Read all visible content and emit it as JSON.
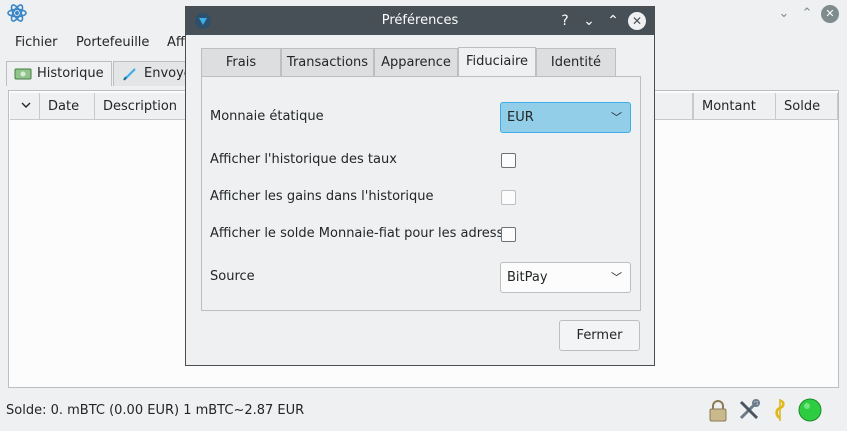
{
  "main_window": {
    "menu": [
      "Fichier",
      "Portefeuille",
      "Aff"
    ],
    "tabs": [
      {
        "label": "Historique"
      },
      {
        "label": "Envoye"
      }
    ],
    "history_columns": [
      "Date",
      "Description",
      "Montant",
      "Solde"
    ],
    "status_text": "Solde: 0. mBTC (0.00 EUR)  1 mBTC~2.87 EUR",
    "status_icons": [
      "lock-icon",
      "tools-icon",
      "seed-icon",
      "network-status-icon"
    ]
  },
  "dialog": {
    "title": "Préférences",
    "titlebar_buttons": [
      "?",
      "⌄",
      "⌃",
      "✕"
    ],
    "tabs": [
      "Frais",
      "Transactions",
      "Apparence",
      "Fiduciaire",
      "Identité"
    ],
    "active_tab": "Fiduciaire",
    "fields": {
      "fiat_label": "Monnaie étatique",
      "fiat_value": "EUR",
      "rate_history_label": "Afficher l'historique des taux",
      "rate_history_checked": false,
      "gains_label": "Afficher les gains dans l'historique",
      "gains_checked": false,
      "address_balance_label": "Afficher le solde Monnaie-fiat pour les adresse",
      "address_balance_checked": false,
      "source_label": "Source",
      "source_value": "BitPay"
    },
    "close_button": "Fermer"
  },
  "colors": {
    "titlebar": "#475057",
    "accent": "#3daee9",
    "focused_combo": "#93cee9",
    "status_green": "#2ecc40"
  }
}
